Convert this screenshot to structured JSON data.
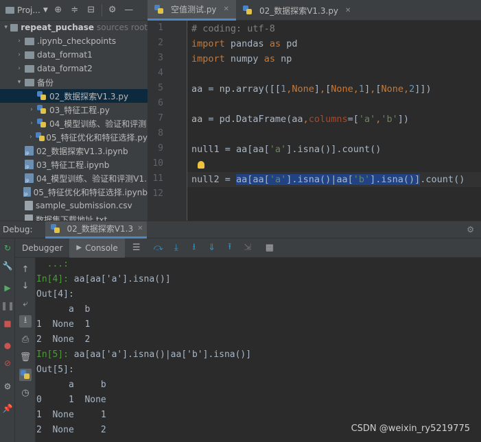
{
  "project_panel": {
    "title": "Proj...",
    "tree": [
      {
        "label": "repeat_puchase",
        "extra": "sources root",
        "type": "root-folder",
        "indent": 0,
        "arrow": "▾"
      },
      {
        "label": ".ipynb_checkpoints",
        "type": "folder",
        "indent": 1,
        "arrow": "›"
      },
      {
        "label": "data_format1",
        "type": "folder",
        "indent": 1,
        "arrow": "›"
      },
      {
        "label": "data_format2",
        "type": "folder",
        "indent": 1,
        "arrow": "›"
      },
      {
        "label": "备份",
        "type": "folder",
        "indent": 1,
        "arrow": "▾"
      },
      {
        "label": "02_数据探索V1.3.py",
        "type": "py",
        "indent": 2,
        "arrow": "",
        "selected": true
      },
      {
        "label": "03_特征工程.py",
        "type": "py",
        "indent": 2,
        "arrow": "›"
      },
      {
        "label": "04_模型训练、验证和评测",
        "type": "py",
        "indent": 2,
        "arrow": "›"
      },
      {
        "label": "05_特征优化和特征选择.py",
        "type": "py",
        "indent": 2,
        "arrow": "›"
      },
      {
        "label": "02_数据探索V1.3.ipynb",
        "type": "nb",
        "indent": 1,
        "arrow": ""
      },
      {
        "label": "03_特征工程.ipynb",
        "type": "nb",
        "indent": 1,
        "arrow": ""
      },
      {
        "label": "04_模型训练、验证和评测V1.",
        "type": "nb",
        "indent": 1,
        "arrow": ""
      },
      {
        "label": "05_特征优化和特征选择.ipynb",
        "type": "nb",
        "indent": 1,
        "arrow": ""
      },
      {
        "label": "sample_submission.csv",
        "type": "csv",
        "indent": 1,
        "arrow": ""
      },
      {
        "label": "数据集下载地址.txt",
        "type": "csv",
        "indent": 1,
        "arrow": ""
      }
    ]
  },
  "tabs": [
    {
      "label": "空值测试.py",
      "active": true
    },
    {
      "label": "02_数据探索V1.3.py",
      "active": false
    }
  ],
  "editor": {
    "line_numbers": [
      "1",
      "2",
      "3",
      "4",
      "5",
      "6",
      "7",
      "8",
      "9",
      "10",
      "11",
      "12"
    ]
  },
  "debug": {
    "label": "Debug:",
    "tab": "02_数据探索V1.3",
    "subtabs": {
      "debugger": "Debugger",
      "console": "Console"
    }
  },
  "console_lines": [
    {
      "t": "cont",
      "text": "  ...:"
    },
    {
      "t": "in",
      "prompt": "In[4]:",
      "text": " aa[aa['a'].isna()]"
    },
    {
      "t": "out",
      "text": "Out[4]:"
    },
    {
      "t": "plain",
      "text": "      a  b"
    },
    {
      "t": "plain",
      "text": "1  None  1"
    },
    {
      "t": "plain",
      "text": "2  None  2"
    },
    {
      "t": "in",
      "prompt": "In[5]:",
      "text": " aa[aa['a'].isna()|aa['b'].isna()]"
    },
    {
      "t": "out",
      "text": "Out[5]:"
    },
    {
      "t": "plain",
      "text": "      a     b"
    },
    {
      "t": "plain",
      "text": "0     1  None"
    },
    {
      "t": "plain",
      "text": "1  None     1"
    },
    {
      "t": "plain",
      "text": "2  None     2"
    }
  ],
  "watermark": "CSDN @weixin_ry5219775"
}
